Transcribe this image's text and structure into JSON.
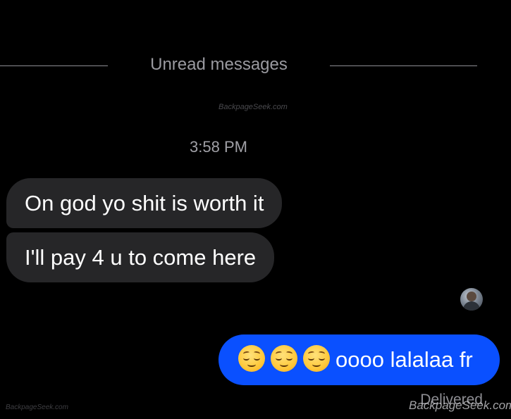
{
  "divider": {
    "label": "Unread messages"
  },
  "watermarks": {
    "top": "BackpageSeek.com",
    "bottom_left": "BackpageSeek.com",
    "bottom_right": "BackpageSeek.com"
  },
  "timestamp": "3:58 PM",
  "messages": [
    {
      "direction": "incoming",
      "text": "On god yo shit is worth it"
    },
    {
      "direction": "incoming",
      "text": "I'll pay 4 u to come here"
    },
    {
      "direction": "outgoing",
      "emoji": [
        "relieved-face",
        "relieved-face",
        "relieved-face"
      ],
      "text": "oooo lalalaa fr"
    }
  ],
  "status": {
    "delivered": "Delivered"
  },
  "colors": {
    "background": "#000000",
    "incoming_bubble": "#262628",
    "outgoing_bubble": "#0a50ff",
    "secondary_text": "#8e8e93"
  }
}
